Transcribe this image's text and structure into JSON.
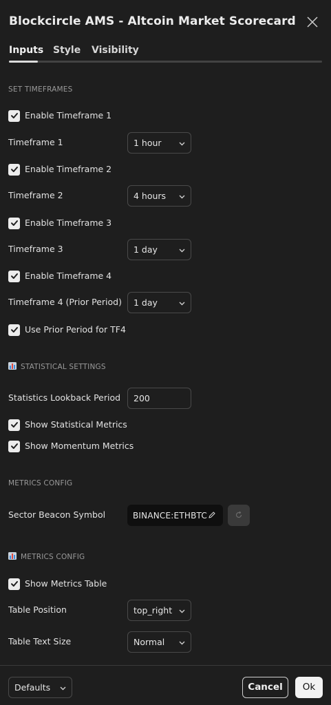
{
  "dialog": {
    "title": "Blockcircle AMS - Altcoin Market Scorecard"
  },
  "tabs": [
    {
      "label": "Inputs",
      "active": true
    },
    {
      "label": "Style",
      "active": false
    },
    {
      "label": "Visibility",
      "active": false
    }
  ],
  "sections": {
    "timeframes": {
      "title": "SET TIMEFRAMES"
    },
    "statistical": {
      "title": "STATISTICAL SETTINGS",
      "icon": "bar-chart-emoji"
    },
    "metrics_config": {
      "title": "METRICS CONFIG"
    },
    "metrics_config_2": {
      "title": "METRICS CONFIG",
      "icon": "bar-chart-emoji"
    }
  },
  "timeframes": {
    "enable_tf1": {
      "label": "Enable Timeframe 1",
      "checked": true
    },
    "tf1": {
      "label": "Timeframe 1",
      "value": "1 hour"
    },
    "enable_tf2": {
      "label": "Enable Timeframe 2",
      "checked": true
    },
    "tf2": {
      "label": "Timeframe 2",
      "value": "4 hours"
    },
    "enable_tf3": {
      "label": "Enable Timeframe 3",
      "checked": true
    },
    "tf3": {
      "label": "Timeframe 3",
      "value": "1 day"
    },
    "enable_tf4": {
      "label": "Enable Timeframe 4",
      "checked": true
    },
    "tf4": {
      "label": "Timeframe 4 (Prior Period)",
      "value": "1 day"
    },
    "use_prior": {
      "label": "Use Prior Period for TF4",
      "checked": true
    }
  },
  "statistical": {
    "lookback": {
      "label": "Statistics Lookback Period",
      "value": "200"
    },
    "show_stats": {
      "label": "Show Statistical Metrics",
      "checked": true
    },
    "show_momentum": {
      "label": "Show Momentum Metrics",
      "checked": true
    }
  },
  "metrics": {
    "beacon": {
      "label": "Sector Beacon Symbol",
      "value": "BINANCE:ETHBTC"
    },
    "show_table": {
      "label": "Show Metrics Table",
      "checked": true
    },
    "position": {
      "label": "Table Position",
      "value": "top_right"
    },
    "text_size": {
      "label": "Table Text Size",
      "value": "Normal"
    }
  },
  "footer": {
    "defaults": "Defaults",
    "cancel": "Cancel",
    "ok": "Ok"
  },
  "colors": {
    "background": "#1e1e1e",
    "checkbox": "#ececec",
    "border": "#4a4a4a"
  }
}
